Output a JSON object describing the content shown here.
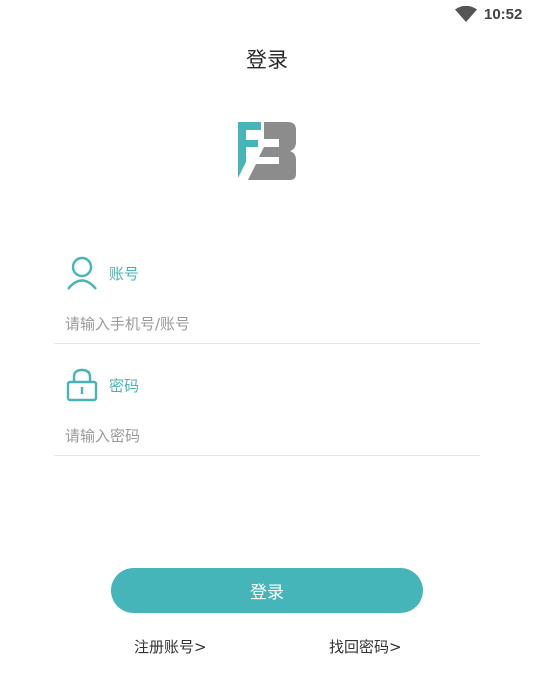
{
  "status_bar": {
    "time": "10:52",
    "wifi_icon": "wifi-icon"
  },
  "header": {
    "title": "登录"
  },
  "logo": {
    "icon": "fb-logo-icon",
    "colors": {
      "teal": "#46b5b9",
      "gray": "#8c8c8c"
    }
  },
  "form": {
    "account": {
      "icon": "user-icon",
      "label": "账号",
      "placeholder": "请输入手机号/账号",
      "value": ""
    },
    "password": {
      "icon": "lock-icon",
      "label": "密码",
      "placeholder": "请输入密码",
      "value": ""
    },
    "submit_label": "登录"
  },
  "links": {
    "register": "注册账号>",
    "forgot": "找回密码>"
  },
  "colors": {
    "accent": "#46b5b9",
    "divider": "#e6e6e6",
    "placeholder": "#9a9a9a"
  }
}
